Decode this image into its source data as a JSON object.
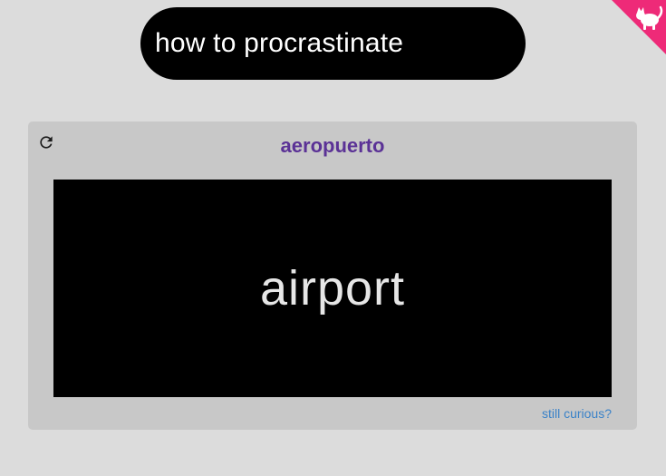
{
  "search": {
    "value": "how to procrastinate"
  },
  "corner": {
    "icon": "cat-icon",
    "color": "#ee2a78"
  },
  "card": {
    "refresh_icon": "refresh-icon",
    "title": "aeropuerto",
    "answer": "airport",
    "link_label": "still curious?"
  },
  "colors": {
    "background": "#dcdcdc",
    "card": "#c8c8c8",
    "title": "#5b3296",
    "link": "#3a82c8"
  }
}
